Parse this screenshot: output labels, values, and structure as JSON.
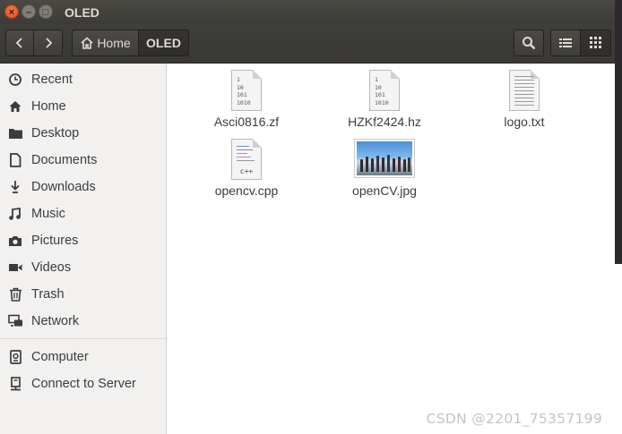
{
  "window": {
    "title": "OLED",
    "close_symbol": "×",
    "minimize_symbol": "–",
    "maximize_symbol": "□"
  },
  "toolbar": {
    "back_icon": "chevron-left-icon",
    "forward_icon": "chevron-right-icon",
    "breadcrumb": [
      {
        "label": "Home",
        "icon": "home-icon"
      },
      {
        "label": "OLED"
      }
    ],
    "search_icon": "search-icon",
    "list_view_icon": "list-view-icon",
    "grid_view_icon": "grid-view-icon"
  },
  "sidebar": {
    "places": [
      {
        "label": "Recent",
        "icon": "clock-icon"
      },
      {
        "label": "Home",
        "icon": "home-icon"
      },
      {
        "label": "Desktop",
        "icon": "folder-icon"
      },
      {
        "label": "Documents",
        "icon": "document-icon"
      },
      {
        "label": "Downloads",
        "icon": "download-icon"
      },
      {
        "label": "Music",
        "icon": "music-icon"
      },
      {
        "label": "Pictures",
        "icon": "camera-icon"
      },
      {
        "label": "Videos",
        "icon": "video-icon"
      },
      {
        "label": "Trash",
        "icon": "trash-icon"
      },
      {
        "label": "Network",
        "icon": "network-icon"
      }
    ],
    "devices": [
      {
        "label": "Computer",
        "icon": "computer-icon"
      },
      {
        "label": "Connect to Server",
        "icon": "server-icon"
      }
    ]
  },
  "files": [
    {
      "name": "Asci0816.zf",
      "type": "binary",
      "preview": [
        "1",
        "10",
        "101",
        "1010"
      ]
    },
    {
      "name": "HZKf2424.hz",
      "type": "binary",
      "preview": [
        "1",
        "10",
        "101",
        "1010"
      ]
    },
    {
      "name": "logo.txt",
      "type": "text"
    },
    {
      "name": "opencv.cpp",
      "type": "cpp",
      "preview_label": "c++"
    },
    {
      "name": "openCV.jpg",
      "type": "image"
    }
  ],
  "watermark": "CSDN @2201_75357199",
  "colors": {
    "titlebar": "#3c3b37",
    "close_button": "#df4a16",
    "sidebar_bg": "#f2f1f0"
  }
}
